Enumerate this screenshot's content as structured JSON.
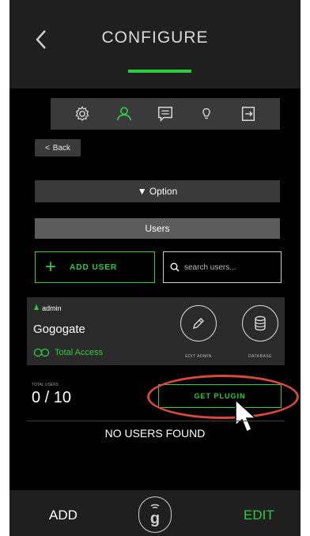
{
  "header": {
    "title": "CONFIGURE",
    "accent": "#2ecc40"
  },
  "tabs": [
    {
      "icon": "gear-icon"
    },
    {
      "icon": "user-icon",
      "active": true
    },
    {
      "icon": "chat-icon"
    },
    {
      "icon": "lightbulb-icon"
    },
    {
      "icon": "logout-icon"
    }
  ],
  "nav": {
    "back_label": "Back"
  },
  "option": {
    "label": "▼ Option"
  },
  "users_section": {
    "title": "Users",
    "add_user_label": "ADD USER",
    "search_placeholder": "search users..."
  },
  "user_card": {
    "role": "admin",
    "name": "Gogogate",
    "access": "Total Access",
    "edit_admin_label": "EDIT ADMIN",
    "database_label": "DATABASE"
  },
  "totals": {
    "label": "TOTAL USERS",
    "value": "0 / 10",
    "get_plugin_label": "GET PLUGIN"
  },
  "empty_state": "NO USERS FOUND",
  "bottom_bar": {
    "add_label": "ADD",
    "edit_label": "EDIT"
  }
}
